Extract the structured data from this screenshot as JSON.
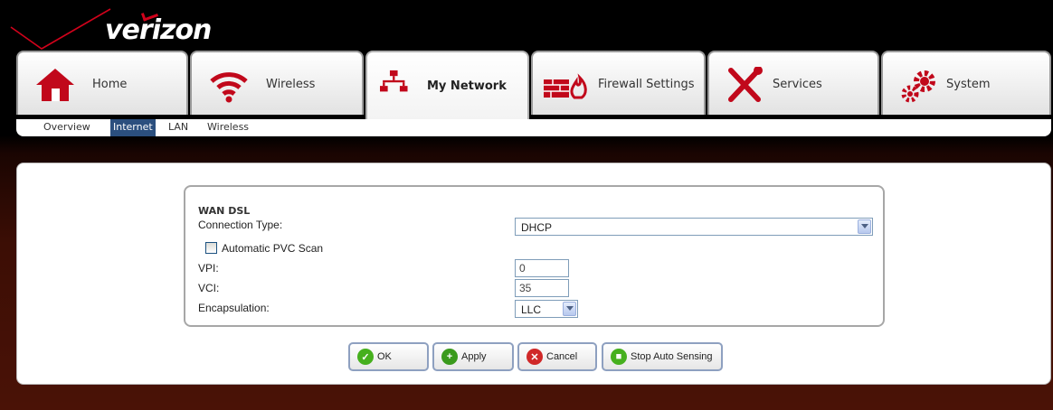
{
  "brand": {
    "name": "verizon"
  },
  "tabs": [
    {
      "label": "Home",
      "icon": "home-icon"
    },
    {
      "label": "Wireless",
      "icon": "wifi-icon"
    },
    {
      "label": "My Network",
      "icon": "network-icon",
      "active": true
    },
    {
      "label": "Firewall Settings",
      "icon": "firewall-icon"
    },
    {
      "label": "Services",
      "icon": "tools-icon"
    },
    {
      "label": "System",
      "icon": "gears-icon"
    }
  ],
  "subnav": [
    {
      "label": "Overview"
    },
    {
      "label": "Internet",
      "active": true
    },
    {
      "label": "LAN"
    },
    {
      "label": "Wireless"
    }
  ],
  "form": {
    "section_title": "WAN DSL",
    "connection_type_label": "Connection Type:",
    "connection_type_value": "DHCP",
    "auto_pvc_label": "Automatic PVC Scan",
    "vpi_label": "VPI:",
    "vpi_value": "0",
    "vci_label": "VCI:",
    "vci_value": "35",
    "encapsulation_label": "Encapsulation:",
    "encapsulation_value": "LLC"
  },
  "buttons": {
    "ok": "OK",
    "apply": "Apply",
    "cancel": "Cancel",
    "stop_auto_sensing": "Stop Auto Sensing"
  },
  "colors": {
    "brand_red": "#d0021b",
    "active_subnav": "#2b4f7e",
    "ok_green": "#46b01e",
    "apply_green": "#3a9a1c",
    "cancel_red": "#d02828"
  }
}
